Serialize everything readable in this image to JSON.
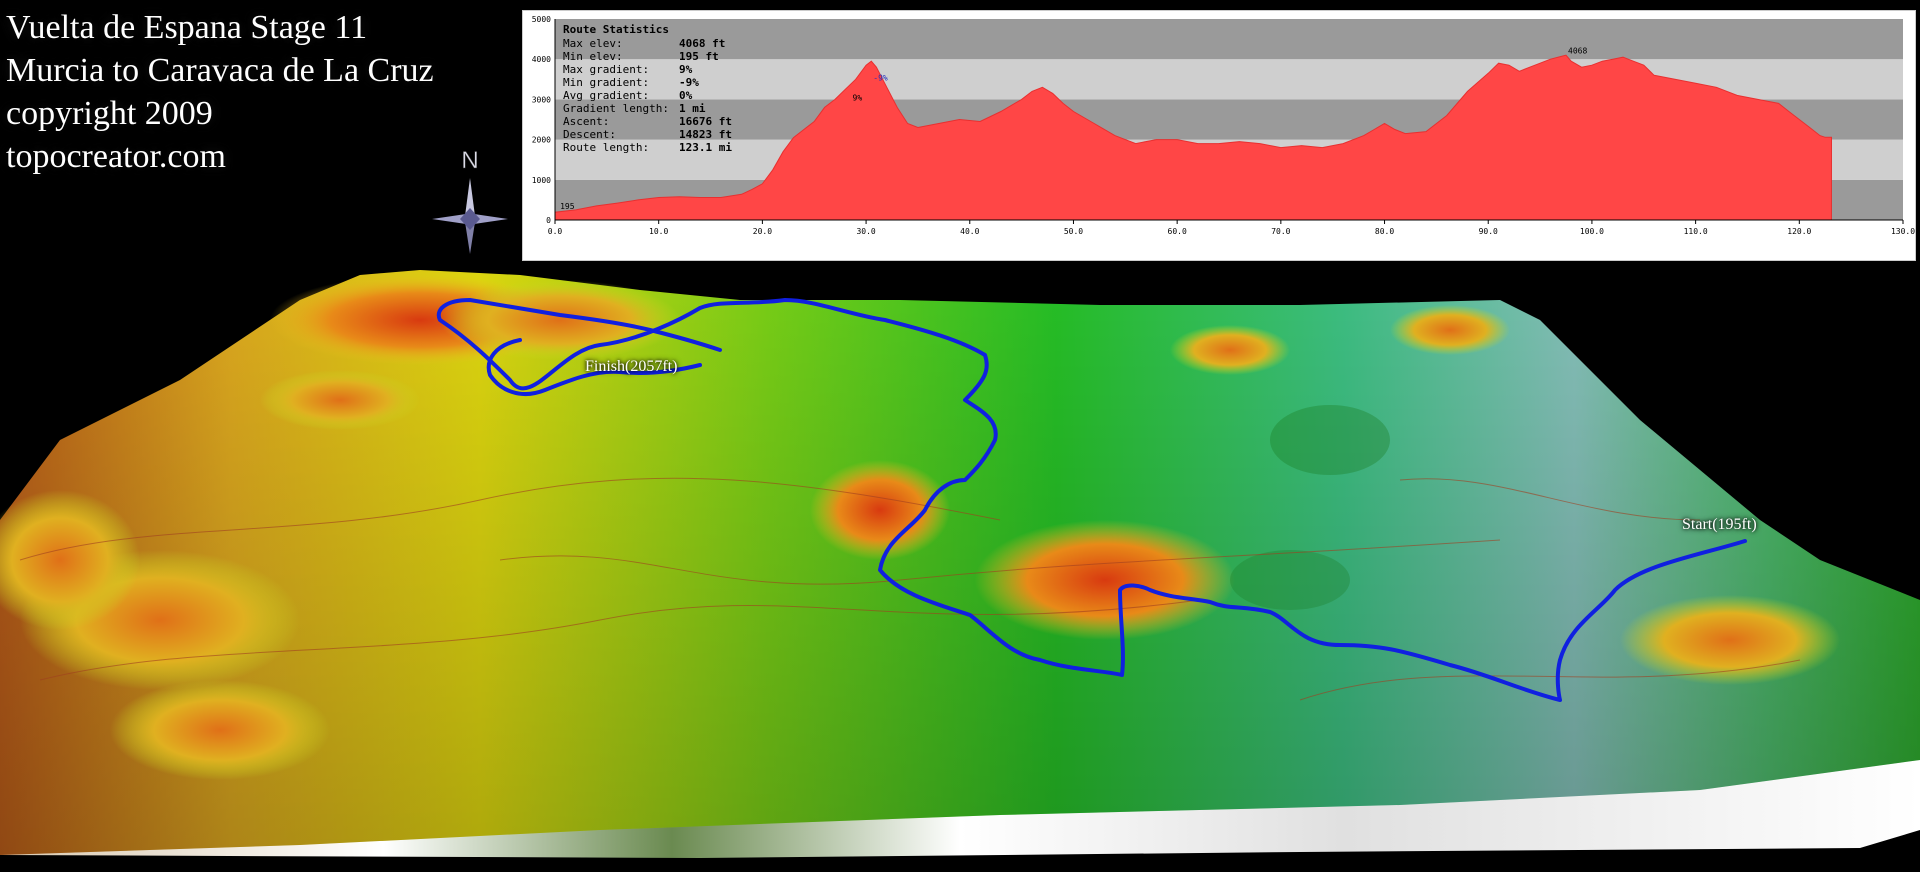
{
  "title": {
    "lines": [
      "Vuelta de Espana Stage 11",
      "Murcia to Caravaca de La Cruz",
      "copyright 2009",
      "topocreator.com"
    ]
  },
  "compass": {
    "label": "N"
  },
  "route_stats": {
    "heading": "Route Statistics",
    "rows": [
      {
        "label": "Max elev:",
        "value": "4068 ft"
      },
      {
        "label": "Min elev:",
        "value": "195 ft"
      },
      {
        "label": "Max gradient:",
        "value": "9%"
      },
      {
        "label": "Min gradient:",
        "value": "-9%"
      },
      {
        "label": "Avg gradient:",
        "value": "0%"
      },
      {
        "label": "Gradient length:",
        "value": "1 mi"
      },
      {
        "label": "Ascent:",
        "value": "16676 ft"
      },
      {
        "label": "Descent:",
        "value": "14823 ft"
      },
      {
        "label": "Route length:",
        "value": "123.1 mi"
      }
    ]
  },
  "map_labels": {
    "finish": "Finish(2057ft)",
    "start": "Start(195ft)"
  },
  "colors": {
    "route": "#1020e0",
    "profile_fill": "#ff4646",
    "band_dark": "#9a9a9a",
    "band_light": "#cfcfcf"
  },
  "chart_data": {
    "type": "area",
    "title": "",
    "xlabel": "",
    "ylabel": "",
    "xlim": [
      0,
      130
    ],
    "ylim": [
      0,
      5000
    ],
    "x_ticks": [
      "0.0",
      "10.0",
      "20.0",
      "30.0",
      "40.0",
      "50.0",
      "60.0",
      "70.0",
      "80.0",
      "90.0",
      "100.0",
      "110.0",
      "120.0",
      "130.0"
    ],
    "y_ticks": [
      "0",
      "1000",
      "2000",
      "3000",
      "4000",
      "5000"
    ],
    "annotations": [
      {
        "text": "195",
        "x": 0.3,
        "y": 195
      },
      {
        "text": "4068",
        "x": 97.5,
        "y": 4068
      },
      {
        "text": "9%",
        "x": 28.5,
        "y": 2900
      },
      {
        "text": "-9%",
        "x": 30.5,
        "y": 3400
      }
    ],
    "series": [
      {
        "x": [
          0,
          2,
          4,
          6,
          8,
          10,
          12,
          14,
          16,
          18,
          19,
          20,
          21,
          22,
          23,
          24,
          25,
          26,
          27,
          28,
          29,
          30,
          30.5,
          31,
          32,
          33,
          34,
          35,
          37,
          39,
          41,
          43,
          45,
          46,
          47,
          48,
          49,
          50,
          52,
          54,
          56,
          58,
          60,
          62,
          64,
          66,
          68,
          70,
          72,
          74,
          76,
          78,
          79,
          80,
          81,
          82,
          84,
          86,
          88,
          90,
          91,
          92,
          93,
          94,
          95,
          96,
          97,
          97.5,
          98,
          99,
          100,
          101,
          102,
          103,
          104,
          105,
          106,
          108,
          110,
          112,
          114,
          116,
          118,
          119,
          120,
          121,
          122,
          122.5,
          123.1
        ],
        "y": [
          195,
          250,
          350,
          420,
          500,
          560,
          580,
          560,
          560,
          640,
          760,
          900,
          1250,
          1700,
          2050,
          2250,
          2450,
          2800,
          3000,
          3250,
          3500,
          3850,
          3950,
          3800,
          3300,
          2800,
          2400,
          2300,
          2400,
          2500,
          2450,
          2700,
          3000,
          3200,
          3300,
          3150,
          2900,
          2700,
          2400,
          2100,
          1900,
          2000,
          2000,
          1900,
          1900,
          1950,
          1900,
          1800,
          1850,
          1800,
          1900,
          2100,
          2250,
          2400,
          2250,
          2150,
          2200,
          2600,
          3200,
          3650,
          3900,
          3850,
          3700,
          3800,
          3900,
          4000,
          4068,
          4100,
          3950,
          3800,
          3850,
          3950,
          4000,
          4050,
          3950,
          3850,
          3600,
          3500,
          3400,
          3300,
          3100,
          3000,
          2900,
          2700,
          2500,
          2300,
          2100,
          2057,
          2057
        ]
      }
    ]
  }
}
